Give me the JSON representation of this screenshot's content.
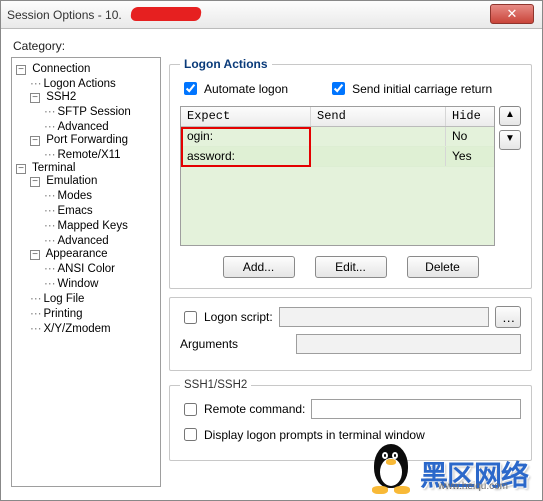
{
  "window": {
    "title": "Session Options - 10."
  },
  "category_label": "Category:",
  "tree": {
    "connection": "Connection",
    "logon_actions": "Logon Actions",
    "ssh2": "SSH2",
    "sftp_session": "SFTP Session",
    "advanced": "Advanced",
    "port_forwarding": "Port Forwarding",
    "remote_x11": "Remote/X11",
    "terminal": "Terminal",
    "emulation": "Emulation",
    "modes": "Modes",
    "emacs": "Emacs",
    "mapped_keys": "Mapped Keys",
    "advanced2": "Advanced",
    "appearance": "Appearance",
    "ansi_color": "ANSI Color",
    "window": "Window",
    "log_file": "Log File",
    "printing": "Printing",
    "xyzmodem": "X/Y/Zmodem"
  },
  "panel": {
    "title": "Logon Actions",
    "automate_logon": "Automate logon",
    "send_cr": "Send initial carriage return",
    "headers": {
      "expect": "Expect",
      "send": "Send",
      "hide": "Hide"
    },
    "rows": [
      {
        "expect": "ogin:",
        "send": "",
        "hide": "No"
      },
      {
        "expect": "assword:",
        "send": "",
        "hide": "Yes"
      }
    ],
    "buttons": {
      "add": "Add...",
      "edit": "Edit...",
      "delete": "Delete"
    }
  },
  "script": {
    "logon_script": "Logon script:",
    "arguments": "Arguments"
  },
  "ssh": {
    "legend": "SSH1/SSH2",
    "remote_command": "Remote command:",
    "display_prompt": "Display logon prompts in terminal window"
  },
  "watermark": {
    "brand": "黑区网络",
    "url": "www.heiqu.com"
  }
}
